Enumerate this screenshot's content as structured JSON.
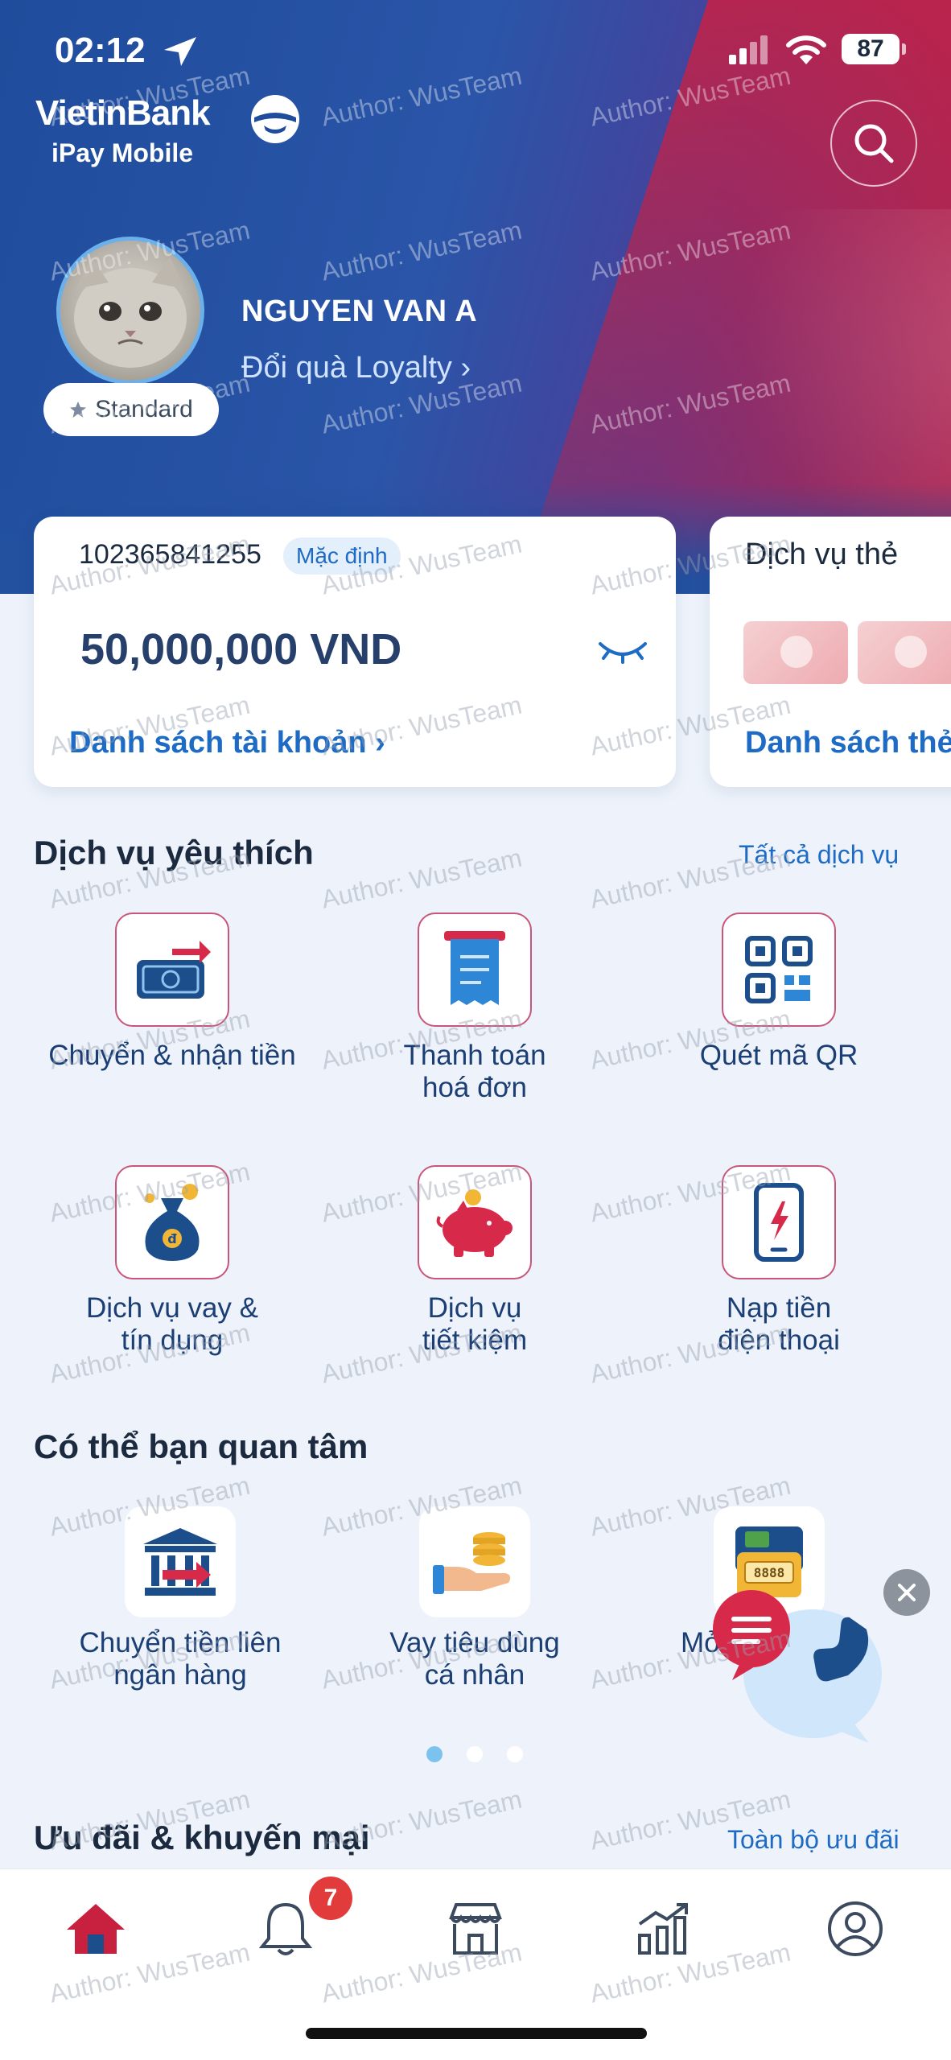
{
  "status_bar": {
    "time": "02:12",
    "battery": "87"
  },
  "brand": {
    "name": "VietinBank",
    "sub": "iPay Mobile"
  },
  "profile": {
    "name": "NGUYEN VAN A",
    "loyalty_link": "Đổi quà Loyalty ›",
    "tier": "Standard"
  },
  "account_card": {
    "account_number": "102365841255",
    "default_tag": "Mặc định",
    "balance": "50,000,000 VND",
    "link": "Danh sách tài khoản ›"
  },
  "service_card": {
    "title": "Dịch vụ thẻ",
    "link": "Danh sách thẻ"
  },
  "favorites": {
    "title": "Dịch vụ yêu thích",
    "see_all": "Tất cả dịch vụ",
    "items": [
      {
        "label": "Chuyển & nhận tiền",
        "icon": "money-transfer-icon"
      },
      {
        "label": "Thanh toán\nhoá đơn",
        "icon": "bill-icon"
      },
      {
        "label": "Quét mã QR",
        "icon": "qr-code-icon"
      },
      {
        "label": "Dịch vụ vay &\ntín dụng",
        "icon": "money-bag-icon"
      },
      {
        "label": "Dịch vụ\ntiết kiệm",
        "icon": "piggy-bank-icon"
      },
      {
        "label": "Nạp tiền\nđiện thoại",
        "icon": "phone-topup-icon"
      }
    ]
  },
  "recommend": {
    "title": "Có thể bạn quan tâm",
    "items": [
      {
        "label": "Chuyển tiền liên\nngân hàng",
        "icon": "bank-transfer-icon"
      },
      {
        "label": "Vay tiêu dùng\ncá nhân",
        "icon": "hand-coins-icon"
      },
      {
        "label": "Mở",
        "icon": "wallet-icon"
      }
    ],
    "wallet_digits": "8888"
  },
  "promotions": {
    "title": "Ưu đãi & khuyến mại",
    "see_all": "Toàn bộ ưu đãi"
  },
  "tabbar": {
    "notification_count": "7",
    "tabs": [
      "home-icon",
      "bell-icon",
      "store-icon",
      "chart-icon",
      "user-icon"
    ]
  },
  "watermark": "Author: WusTeam",
  "colors": {
    "primary_blue": "#1d6bc4",
    "accent_red": "#c8203f",
    "tile_border": "#c8567a"
  }
}
